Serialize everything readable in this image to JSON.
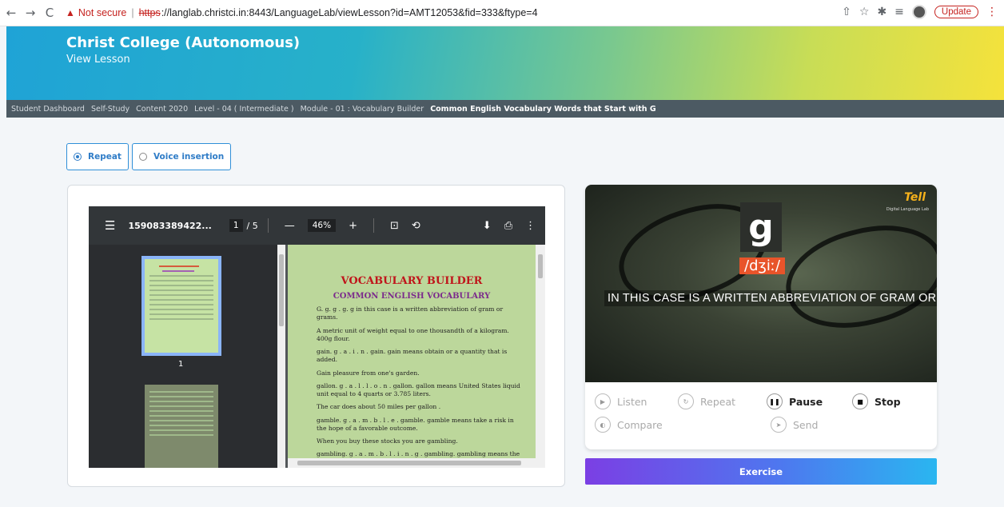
{
  "browser": {
    "back": "←",
    "forward": "→",
    "reload": "C",
    "warning_icon": "▲",
    "not_secure": "Not secure",
    "separator": "|",
    "scheme": "https",
    "url_rest": "://langlab.christci.in:8443/LanguageLab/viewLesson?id=AMT12053&fid=333&ftype=4",
    "update_label": "Update"
  },
  "header": {
    "college": "Christ College (Autonomous)",
    "subtitle": "View Lesson"
  },
  "breadcrumb": [
    "Student Dashboard",
    "Self-Study",
    "Content 2020",
    "Level - 04 ( Intermediate )",
    "Module - 01 : Vocabulary Builder",
    "Common English Vocabulary Words that Start with G"
  ],
  "mode": {
    "repeat": "Repeat",
    "voice": "Voice insertion",
    "selected": "repeat"
  },
  "pdf": {
    "filename": "159083389422...",
    "page": "1",
    "total": "/ 5",
    "zoom": "46%",
    "thumb_label": "1",
    "title": "VOCABULARY BUILDER",
    "subtitle": "COMMON ENGLISH VOCABULARY",
    "lines": [
      "G. g. g . g. g in this case is a written abbreviation of gram or grams.",
      "A metric unit of weight equal to one thousandth of a kilogram. 400g flour.",
      "gain. g . a . i . n . gain. gain means obtain or a quantity that is added.",
      "Gain pleasure from one's garden.",
      "gallon. g . a . l . l . o . n . gallon. gallon means United States liquid unit equal to 4 quarts or 3.785 liters.",
      "The car does about 50 miles per gallon .",
      "gamble. g . a . m . b . l . e . gamble. gamble means take a risk in the hope of a favorable outcome.",
      "When you buy these stocks you are gambling.",
      "gambling. g . a . m . b . l . i . n . g . gambling. gambling means the act of playing for stakes in the hope of winning (including the payment of a"
    ]
  },
  "video": {
    "logo": "Tell",
    "logo_sub": "Digital Language Lab",
    "letter": "g",
    "phonetic": "/dʒiː/",
    "caption": "IN THIS CASE IS A WRITTEN ABBREVIATION OF GRAM OR GRAMS"
  },
  "controls": {
    "listen": "Listen",
    "repeat": "Repeat",
    "pause": "Pause",
    "stop": "Stop",
    "compare": "Compare",
    "send": "Send"
  },
  "exercise_label": "Exercise"
}
